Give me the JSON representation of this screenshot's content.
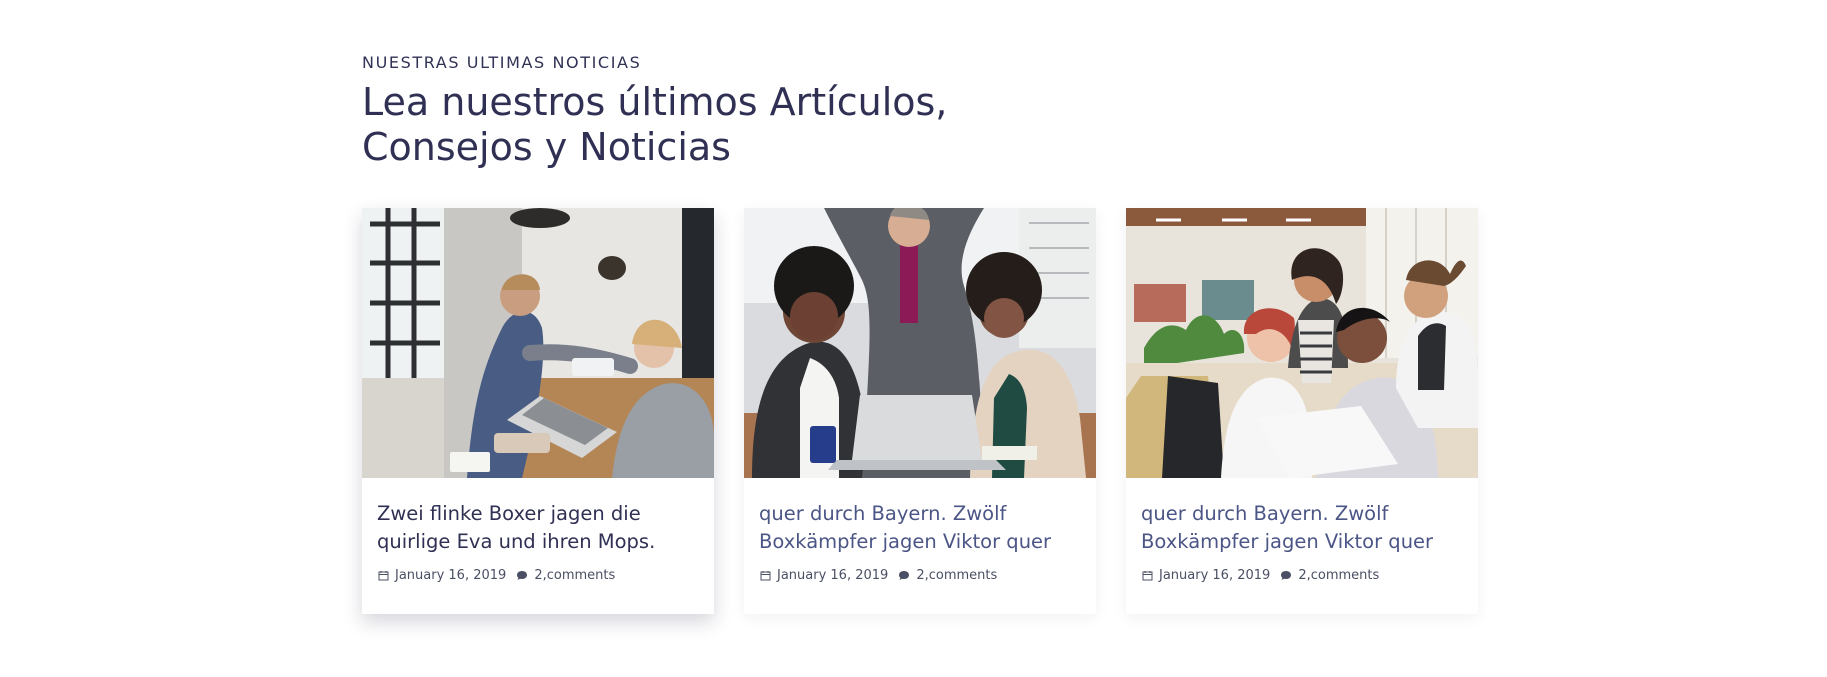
{
  "section": {
    "eyebrow": "NUESTRAS ULTIMAS NOTICIAS",
    "headline": "Lea nuestros últimos Artículos, Consejos y Noticias"
  },
  "cards": [
    {
      "image_icon": "office-handshake-photo",
      "title": "Zwei flinke Boxer jagen die quirlige Eva und ihren Mops.",
      "date": "January 16, 2019",
      "comments": "2,comments"
    },
    {
      "image_icon": "team-laptop-photo",
      "title": "quer durch Bayern. Zwölf Boxkämpfer jagen Viktor quer",
      "date": "January 16, 2019",
      "comments": "2,comments"
    },
    {
      "image_icon": "group-collaboration-photo",
      "title": "quer durch Bayern. Zwölf Boxkämpfer jagen Viktor quer",
      "date": "January 16, 2019",
      "comments": "2,comments"
    }
  ],
  "icons": {
    "date": "calendar-icon",
    "comments": "comment-bubble-icon"
  },
  "colors": {
    "heading": "#2f3053",
    "title_link": "#4b5586",
    "meta": "#4b4f63"
  }
}
